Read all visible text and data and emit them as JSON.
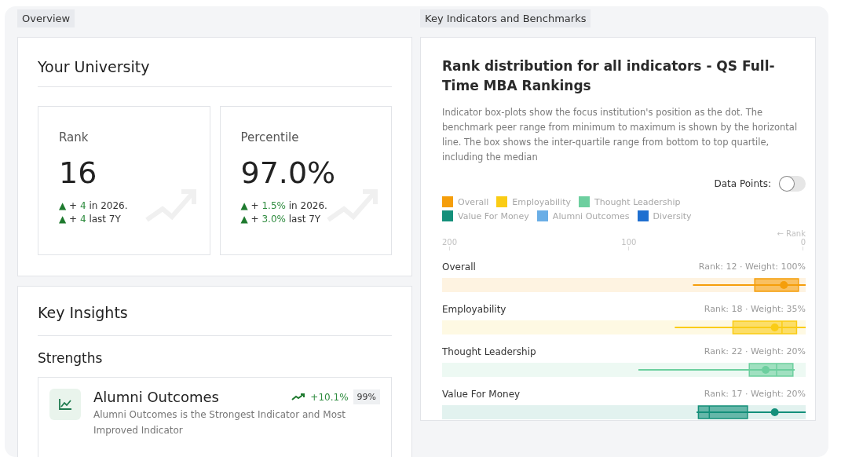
{
  "overview": {
    "tab": "Overview",
    "panel_title": "Your University",
    "stats": [
      {
        "label": "Rank",
        "value": "16",
        "changes": [
          {
            "arrow": "▲",
            "prefix": "+ ",
            "amount": "4",
            "suffix": " in 2026."
          },
          {
            "arrow": "▲",
            "prefix": "+ ",
            "amount": "4",
            "suffix": " last 7Y"
          }
        ]
      },
      {
        "label": "Percentile",
        "value": "97.0%",
        "changes": [
          {
            "arrow": "▲",
            "prefix": "+ ",
            "amount": "1.5%",
            "suffix": " in 2026."
          },
          {
            "arrow": "▲",
            "prefix": "+ ",
            "amount": "3.0%",
            "suffix": " last 7Y"
          }
        ]
      }
    ],
    "insights": {
      "title": "Key Insights",
      "section": "Strengths",
      "items": [
        {
          "title": "Alumni Outcomes",
          "change": "+10.1%",
          "badge": "99%",
          "text": "Alumni Outcomes is the Strongest Indicator and Most Improved Indicator"
        }
      ]
    }
  },
  "benchmarks": {
    "tab": "Key Indicators and Benchmarks",
    "title": "Rank distribution for all indicators - QS Full-Time MBA Rankings",
    "description": "Indicator box-plots show the focus institution's position as the dot. The benchmark peer range from minimum to maximum is shown by the horizontal line. The box shows the inter-quartile range from bottom to top quartile, including the median",
    "toggle": {
      "label": "Data Points:",
      "on": false
    },
    "legend": [
      {
        "label": "Overall",
        "color": "#f59e0b"
      },
      {
        "label": "Employability",
        "color": "#facc15"
      },
      {
        "label": "Thought Leadership",
        "color": "#6dcf9f"
      },
      {
        "label": "Value For Money",
        "color": "#14907a"
      },
      {
        "label": "Alumni Outcomes",
        "color": "#6aaee6"
      },
      {
        "label": "Diversity",
        "color": "#1f6fd0"
      }
    ],
    "axis": {
      "direction": "← Rank",
      "ticks": [
        "200",
        "100",
        "0"
      ]
    },
    "rows": [
      {
        "name": "Overall",
        "info": "Rank: 12 · Weight: 100%",
        "color": "#f59e0b"
      },
      {
        "name": "Employability",
        "info": "Rank: 18 · Weight: 35%",
        "color": "#facc15"
      },
      {
        "name": "Thought Leadership",
        "info": "Rank: 22 · Weight: 20%",
        "color": "#6dcf9f"
      },
      {
        "name": "Value For Money",
        "info": "Rank: 17 · Weight: 20%",
        "color": "#14907a"
      }
    ]
  }
}
